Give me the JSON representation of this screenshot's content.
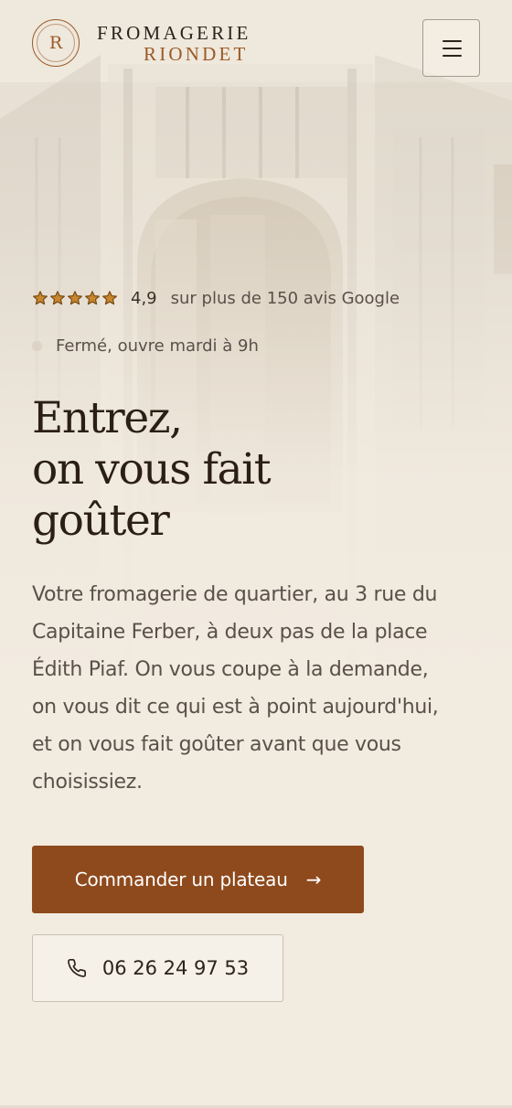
{
  "brand": {
    "monogram": "R",
    "line1": "FROMAGERIE",
    "line2": "RIONDET"
  },
  "menu_icon": "hamburger-menu-icon",
  "rating": {
    "stars": 5,
    "star_icon": "star-icon",
    "value": "4,9",
    "text": "sur plus de 150 avis Google"
  },
  "status": {
    "text": "Fermé, ouvre mardi à 9h"
  },
  "hero": {
    "title_lines": [
      "Entrez,",
      "on vous fait",
      "goûter"
    ],
    "lede_lines": [
      "Votre fromagerie de quartier, au 3 rue du",
      "Capitaine Ferber, à deux pas de la place",
      "Édith Piaf. On vous coupe à la demande,",
      "on vous dit ce qui est à point aujourd'hui,",
      "et on vous fait goûter avant que vous",
      "choisissiez."
    ]
  },
  "cta": {
    "primary_label": "Commander un plateau",
    "primary_icon": "arrow-right-icon",
    "phone_label": "06 26 24 97 53",
    "phone_icon": "phone-icon"
  },
  "colors": {
    "accent": "#8e4a1c",
    "brand_gold": "#9a5a26",
    "star": "#c8872e",
    "background": "#f2ebe0",
    "text_dark": "#2b1f15",
    "text_muted": "#5a5049"
  }
}
